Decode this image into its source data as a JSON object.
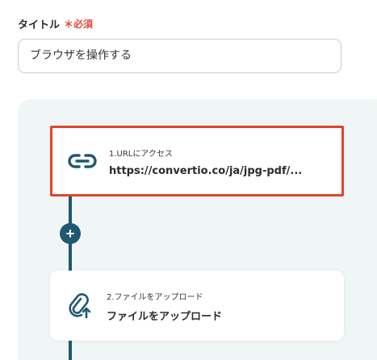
{
  "form": {
    "title_label": "タイトル",
    "required_mark": "＊必須",
    "title_value": "ブラウザを操作する"
  },
  "flow": {
    "steps": [
      {
        "number_label": "1.URLにアクセス",
        "value": "https://convertio.co/ja/jpg-pdf/...",
        "icon": "link-icon"
      },
      {
        "number_label": "2.ファイルをアップロード",
        "value": "ファイルをアップロード",
        "icon": "paperclip-upload-icon"
      }
    ],
    "add_button_icon": "plus-icon"
  },
  "colors": {
    "accent": "#1f5873",
    "required": "#e4473f",
    "highlight_border": "#e3432c",
    "flow_background": "#f0f6f6"
  }
}
